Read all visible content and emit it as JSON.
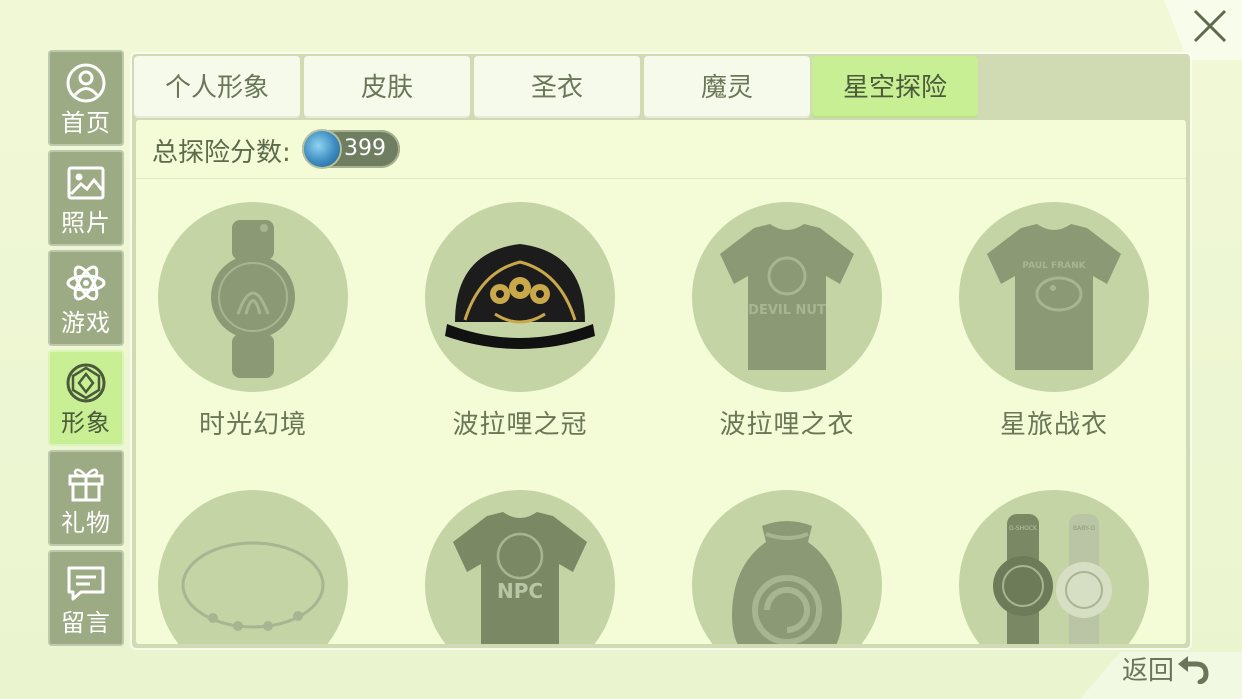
{
  "sidebar": {
    "items": [
      {
        "label": "首页",
        "icon": "user-icon"
      },
      {
        "label": "照片",
        "icon": "photo-icon"
      },
      {
        "label": "游戏",
        "icon": "atom-icon"
      },
      {
        "label": "形象",
        "icon": "diamond-icon",
        "active": true
      },
      {
        "label": "礼物",
        "icon": "gift-icon"
      },
      {
        "label": "留言",
        "icon": "message-icon"
      }
    ]
  },
  "tabs": [
    {
      "label": "个人形象"
    },
    {
      "label": "皮肤"
    },
    {
      "label": "圣衣"
    },
    {
      "label": "魔灵"
    },
    {
      "label": "星空探险",
      "active": true
    }
  ],
  "score": {
    "label": "总探险分数:",
    "value": "399"
  },
  "items": [
    {
      "name": "时光幻境",
      "icon": "watch-icon"
    },
    {
      "name": "波拉哩之冠",
      "icon": "cap-icon"
    },
    {
      "name": "波拉哩之衣",
      "icon": "tshirt-icon",
      "print": "DEVIL NUT"
    },
    {
      "name": "星旅战衣",
      "icon": "tshirt-icon",
      "print": "PAUL FRANK"
    },
    {
      "name": "",
      "icon": "bracelet-icon"
    },
    {
      "name": "",
      "icon": "tshirt-icon",
      "print": "NPC"
    },
    {
      "name": "",
      "icon": "bag-icon"
    },
    {
      "name": "",
      "icon": "watches-icon",
      "print_a": "G-SHOCK",
      "print_b": "BABY-G"
    }
  ],
  "back_label": "返回",
  "colors": {
    "sidebar": "#9cab84",
    "active": "#c9ef95",
    "panel": "#d0dbb3",
    "content": "#f3fbd7",
    "circle": "#c5d4a5",
    "locked_item": "#8b9a74"
  }
}
